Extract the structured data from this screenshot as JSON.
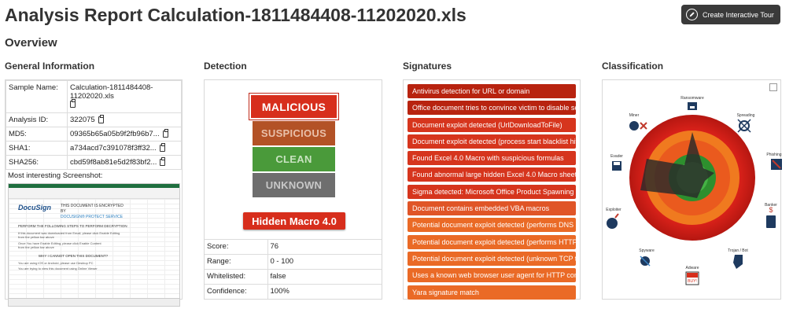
{
  "header": {
    "title": "Analysis Report Calculation-1811484408-11202020.xls",
    "tour_button": "Create Interactive Tour"
  },
  "overview": "Overview",
  "sections": {
    "general": "General Information",
    "detection": "Detection",
    "signatures": "Signatures",
    "classification": "Classification"
  },
  "general_info": {
    "rows": [
      {
        "key": "Sample Name:",
        "value": "Calculation-1811484408-11202020.xls"
      },
      {
        "key": "Analysis ID:",
        "value": "322075"
      },
      {
        "key": "MD5:",
        "value": "09365b65a05b9f2fb96b7..."
      },
      {
        "key": "SHA1:",
        "value": "a734acd7c391078f3ff32..."
      },
      {
        "key": "SHA256:",
        "value": "cbd59f8ab81e5d2f83bf2..."
      }
    ],
    "screenshot_label": "Most interesting Screenshot:",
    "screenshot": {
      "logo": "DocuSign",
      "headline": "THIS DOCUMENT IS ENCRYPTED BY",
      "subhead": "DOCUSIGN® PROTECT SERVICE",
      "step": "PERFORM THE FOLLOWING STEPS TO PERFORM DECRYPTION",
      "line1": "If this document was downloaded from Email, please click Enable Editing",
      "line2": "from the yellow bar above",
      "line3": "Once You have Enable Editing, please click Enable Content",
      "line4": "from the yellow bar above",
      "why": "WHY I CANNOT OPEN THIS DOCUMENT?",
      "reason1": "You are using iOS or Android, please use Desktop PC",
      "reason2": "You are trying to view this document using Online Viewer"
    }
  },
  "detection": {
    "levels": [
      "MALICIOUS",
      "SUSPICIOUS",
      "CLEAN",
      "UNKNOWN"
    ],
    "tag": "Hidden Macro 4.0",
    "rows": [
      {
        "key": "Score:",
        "value": "76"
      },
      {
        "key": "Range:",
        "value": "0 - 100"
      },
      {
        "key": "Whitelisted:",
        "value": "false"
      },
      {
        "key": "Confidence:",
        "value": "100%"
      }
    ]
  },
  "signatures": [
    "Antivirus detection for URL or domain",
    "Office document tries to convince victim to disable se...",
    "Document exploit detected (UrlDownloadToFile)",
    "Document exploit detected (process start blacklist hit)",
    "Found Excel 4.0 Macro with suspicious formulas",
    "Found abnormal large hidden Excel 4.0 Macro sheet",
    "Sigma detected: Microsoft Office Product Spawning ...",
    "Document contains embedded VBA macros",
    "Potential document exploit detected (performs DNS q...",
    "Potential document exploit detected (performs HTTP ...",
    "Potential document exploit detected (unknown TCP tr...",
    "Uses a known web browser user agent for HTTP com...",
    "Yara signature match"
  ],
  "classification": {
    "labels": [
      "Ransomware",
      "Miner",
      "Spreading",
      "Evader",
      "Phishing",
      "Exploiter",
      "Banker",
      "Spyware",
      "Trojan / Bot",
      "Adware"
    ],
    "rings": [
      "malicious",
      "suspicious",
      "clean"
    ],
    "adware_badge": "BUY!"
  },
  "colors": {
    "malicious": "#d72e1c",
    "suspicious": "#b35226",
    "clean": "#4a9a3a",
    "unknown": "#6e6e6e",
    "tour_bg": "#3a3a3a"
  }
}
